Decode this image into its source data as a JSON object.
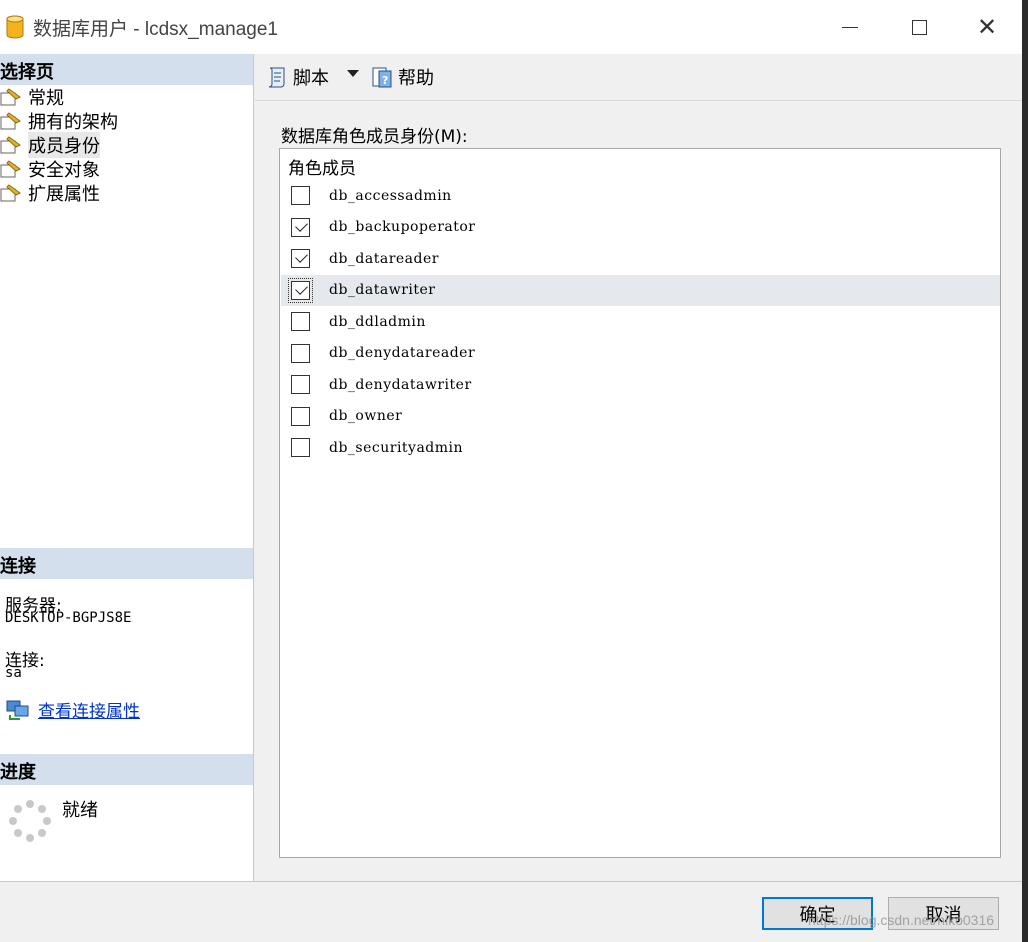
{
  "window": {
    "title": "数据库用户 - lcdsx_manage1"
  },
  "left": {
    "select_page_header": "选择页",
    "nav_items": [
      {
        "label": "常规"
      },
      {
        "label": "拥有的架构"
      },
      {
        "label": "成员身份"
      },
      {
        "label": "安全对象"
      },
      {
        "label": "扩展属性"
      }
    ],
    "selected_index": 2,
    "connection_header": "连接",
    "server_label": "服务器:",
    "server_value": "DESKTOP-BGPJS8E",
    "connection_label": "连接:",
    "connection_value": "sa",
    "view_props_link": "查看连接属性",
    "progress_header": "进度",
    "progress_status": "就绪"
  },
  "toolbar": {
    "script_label": "脚本",
    "help_label": "帮助"
  },
  "roles": {
    "label": "数据库角色成员身份(M):",
    "column_header": "角色成员",
    "items": [
      {
        "name": "db_accessadmin",
        "checked": false
      },
      {
        "name": "db_backupoperator",
        "checked": true
      },
      {
        "name": "db_datareader",
        "checked": true
      },
      {
        "name": "db_datawriter",
        "checked": true
      },
      {
        "name": "db_ddladmin",
        "checked": false
      },
      {
        "name": "db_denydatareader",
        "checked": false
      },
      {
        "name": "db_denydatawriter",
        "checked": false
      },
      {
        "name": "db_owner",
        "checked": false
      },
      {
        "name": "db_securityadmin",
        "checked": false
      }
    ],
    "highlighted_index": 3
  },
  "footer": {
    "ok_label": "确定",
    "cancel_label": "取消",
    "watermark": "https://blog.csdn.net/niko0316"
  }
}
